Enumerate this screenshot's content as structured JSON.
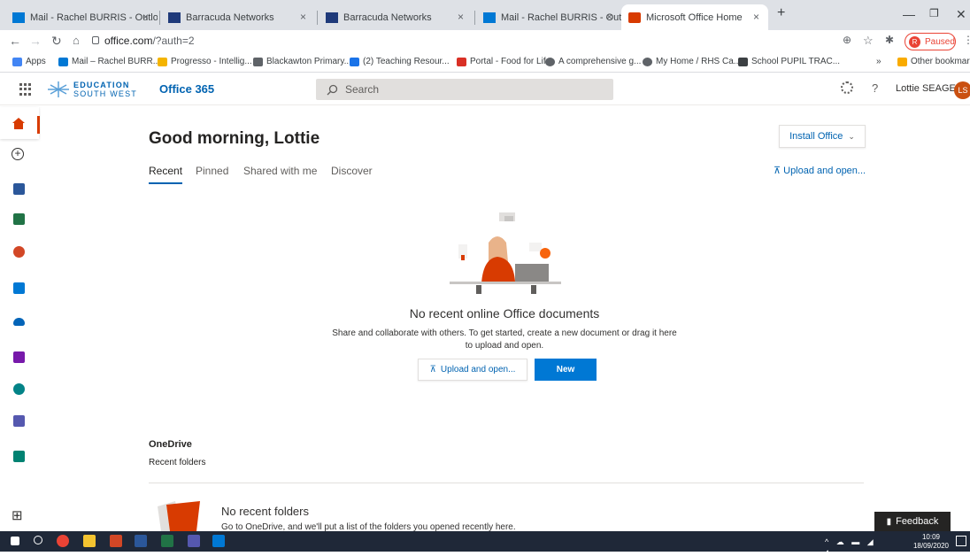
{
  "browser": {
    "tabs": [
      {
        "label": "Mail - Rachel BURRIS - Outlook",
        "favicon_color": "#0078d4"
      },
      {
        "label": "Barracuda Networks",
        "favicon_color": "#1f3a7a"
      },
      {
        "label": "Barracuda Networks",
        "favicon_color": "#1f3a7a"
      },
      {
        "label": "Mail - Rachel BURRIS - Outlook",
        "favicon_color": "#0078d4"
      },
      {
        "label": "Microsoft Office Home",
        "favicon_color": "#d83b01"
      }
    ],
    "tab_close": "×",
    "new_tab": "+",
    "url_host": "office.com",
    "url_path": "/?auth=2",
    "profile_initial": "R",
    "profile_status": "Paused",
    "bookmarks": [
      {
        "label": "Apps",
        "color": "#4285f4"
      },
      {
        "label": "Mail – Rachel BURR...",
        "color": "#0078d4"
      },
      {
        "label": "Progresso - Intellig...",
        "color": "#f4b400"
      },
      {
        "label": "Blackawton Primary...",
        "color": "#5f6368"
      },
      {
        "label": "(2) Teaching Resour...",
        "color": "#1a73e8"
      },
      {
        "label": "Portal - Food for Life",
        "color": "#d93025"
      },
      {
        "label": "A comprehensive g...",
        "color": "#5f6368"
      },
      {
        "label": "My Home / RHS Ca...",
        "color": "#5f6368"
      },
      {
        "label": "School PUPIL TRAC...",
        "color": "#3c4043"
      }
    ],
    "more_bookmarks": "»",
    "other_bookmarks": "Other bookmarks"
  },
  "header": {
    "org_line1": "EDUCATION",
    "org_line2": "SOUTH WEST",
    "app_title": "Office 365",
    "search_placeholder": "Search",
    "help_glyph": "?",
    "user_name": "Lottie SEAGER",
    "user_initials": "LS"
  },
  "rail": {
    "apps": [
      {
        "name": "word",
        "color": "#2b579a"
      },
      {
        "name": "excel",
        "color": "#217346"
      },
      {
        "name": "powerpoint",
        "color": "#d24726"
      },
      {
        "name": "outlook",
        "color": "#0078d4"
      },
      {
        "name": "onedrive",
        "color": "#0364b8"
      },
      {
        "name": "onenote",
        "color": "#7719aa"
      },
      {
        "name": "sharepoint",
        "color": "#038387"
      },
      {
        "name": "teams",
        "color": "#5558af"
      },
      {
        "name": "sway",
        "color": "#008272"
      }
    ]
  },
  "main": {
    "greeting": "Good morning, Lottie",
    "install_office": "Install Office",
    "tabs": [
      "Recent",
      "Pinned",
      "Shared with me",
      "Discover"
    ],
    "upload_open": "Upload and open...",
    "empty_title": "No recent online Office documents",
    "empty_desc_line1": "Share and collaborate with others. To get started, create a new document or drag it here",
    "empty_desc_line2": "to upload and open.",
    "btn_upload": "Upload and open...",
    "btn_new": "New",
    "onedrive_title": "OneDrive",
    "onedrive_sub": "Recent folders",
    "no_folders_title": "No recent folders",
    "no_folders_desc": "Go to OneDrive, and we'll put a list of the folders you opened recently here."
  },
  "feedback": "Feedback",
  "taskbar": {
    "time": "10:09",
    "date": "18/09/2020"
  }
}
